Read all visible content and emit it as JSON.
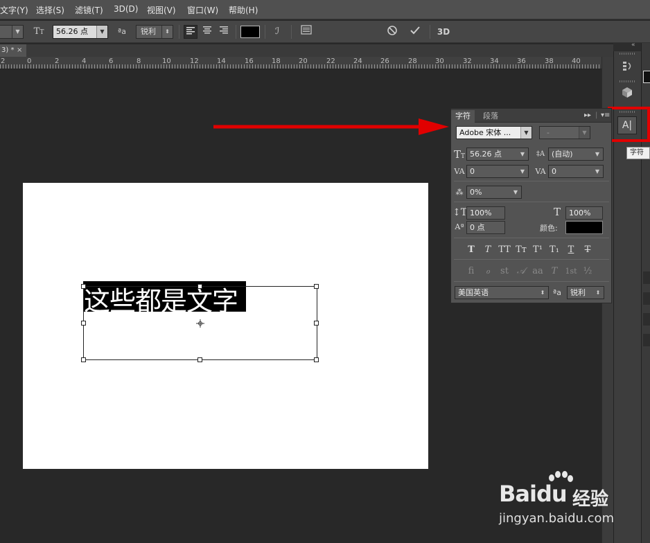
{
  "menu": [
    "文字(Y)",
    "选择(S)",
    "滤镜(T)",
    "3D(D)",
    "视图(V)",
    "窗口(W)",
    "帮助(H)"
  ],
  "options_bar": {
    "font_size": "56.26 点",
    "aa_label": "ªa",
    "antialias": "锐利",
    "icons": [
      "text-orientation-icon",
      "font-size-icon",
      "antialias-icon",
      "align-left-icon",
      "align-center-icon",
      "align-right-icon",
      "warp-text-icon",
      "panels-toggle-icon",
      "cancel-icon",
      "commit-icon",
      "3d-icon"
    ],
    "three_d": "3D",
    "text_color": "#000000"
  },
  "doc_tab": {
    "label": "3) *",
    "close": "×"
  },
  "ruler": {
    "labels": [
      "2",
      "0",
      "2",
      "4",
      "6",
      "8",
      "10",
      "12",
      "14",
      "16",
      "18",
      "20",
      "22",
      "24",
      "26",
      "28",
      "30",
      "32",
      "34",
      "36",
      "38",
      "40"
    ]
  },
  "canvas": {
    "text": "这些都是文字",
    "background": "#ffffff",
    "highlight": "#000000"
  },
  "character_panel": {
    "tabs": [
      "字符",
      "段落"
    ],
    "font_family": "Adobe 宋体 ...",
    "font_style": "-",
    "font_size": "56.26 点",
    "leading": "(自动)",
    "kerning": "0",
    "tracking": "0",
    "tsume": "0%",
    "vertical_scale": "100%",
    "horizontal_scale": "100%",
    "baseline_shift": "0 点",
    "color_label": "颜色:",
    "color": "#000000",
    "style_buttons": [
      "T",
      "T",
      "TT",
      "Tт",
      "T¹",
      "T₁",
      "T",
      "T"
    ],
    "opentype_buttons": [
      "fi",
      "ℴ",
      "st",
      "𝒜",
      "aa",
      "T",
      "1st",
      "½"
    ],
    "language": "美国英语",
    "aa_label": "ªa",
    "antialias": "锐利"
  },
  "dock": {
    "char_button": "A|",
    "tooltip": "字符"
  },
  "annotation": {
    "arrow_color": "#e10000",
    "box_color": "#e10000"
  },
  "watermark": {
    "logo_left": "Bai",
    "logo_right": "du",
    "cn": "经验",
    "url": "jingyan.baidu.com"
  }
}
